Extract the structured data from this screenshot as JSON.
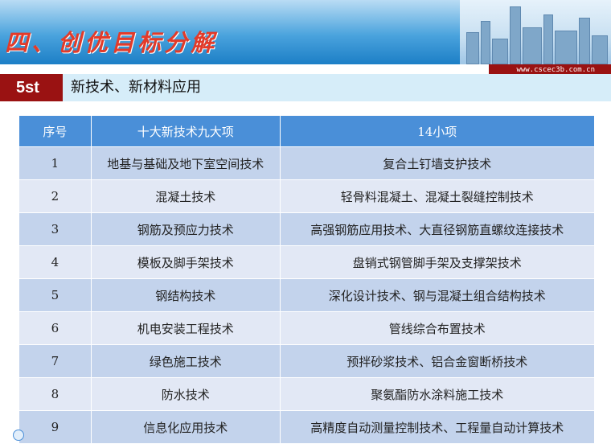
{
  "header": {
    "title": "四、创优目标分解",
    "url": "www.cscec3b.com.cn"
  },
  "section": {
    "badge": "5st",
    "title": "新技术、新材料应用"
  },
  "table": {
    "headers": [
      "序号",
      "十大新技术九大项",
      "14小项"
    ],
    "rows": [
      [
        "1",
        "地基与基础及地下室空间技术",
        "复合土钉墙支护技术"
      ],
      [
        "2",
        "混凝土技术",
        "轻骨料混凝土、混凝土裂缝控制技术"
      ],
      [
        "3",
        "钢筋及预应力技术",
        "高强钢筋应用技术、大直径钢筋直螺纹连接技术"
      ],
      [
        "4",
        "模板及脚手架技术",
        "盘销式钢管脚手架及支撑架技术"
      ],
      [
        "5",
        "钢结构技术",
        "深化设计技术、钢与混凝土组合结构技术"
      ],
      [
        "6",
        "机电安装工程技术",
        "管线综合布置技术"
      ],
      [
        "7",
        "绿色施工技术",
        "预拌砂浆技术、铝合金窗断桥技术"
      ],
      [
        "8",
        "防水技术",
        "聚氨酯防水涂料施工技术"
      ],
      [
        "9",
        "信息化应用技术",
        "高精度自动测量控制技术、工程量自动计算技术"
      ]
    ]
  }
}
